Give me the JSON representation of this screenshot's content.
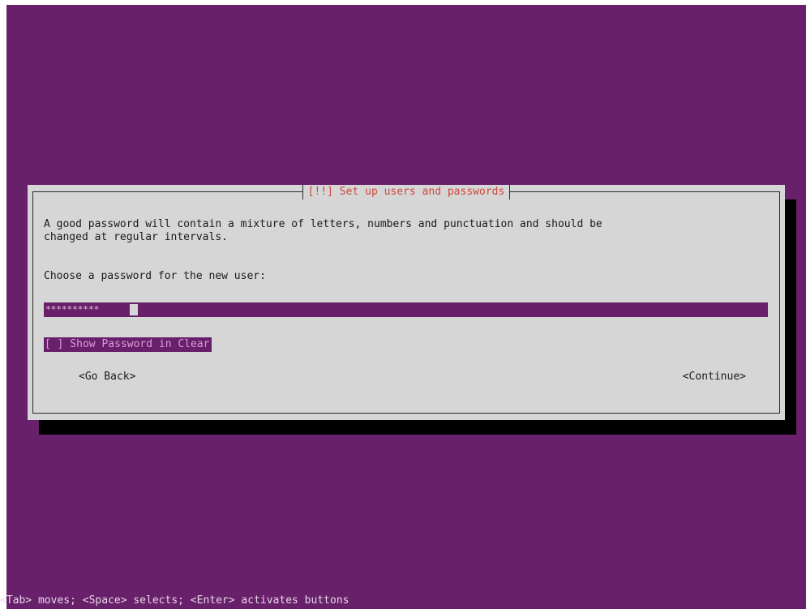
{
  "dialog": {
    "title": "[!!] Set up users and passwords",
    "description": "A good password will contain a mixture of letters, numbers and punctuation and should be\nchanged at regular intervals.",
    "prompt": "Choose a password for the new user:",
    "password_mask": "**********",
    "show_password_label": "[ ] Show Password in Clear",
    "go_back_label": "<Go Back>",
    "continue_label": "<Continue>"
  },
  "status_bar": {
    "help_text": "<Tab> moves; <Space> selects; <Enter> activates buttons"
  },
  "colors": {
    "background": "#69206b",
    "dialog": "#d6d6d6",
    "title": "#d0463a",
    "highlight": "#69206b"
  }
}
